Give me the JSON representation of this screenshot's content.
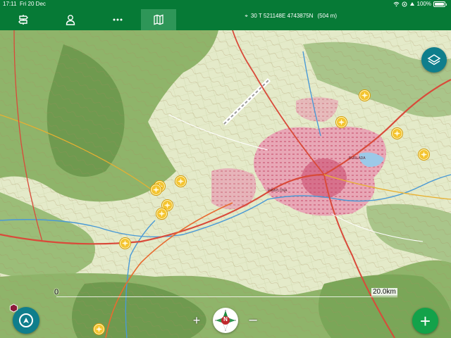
{
  "status_bar": {
    "time": "17:11",
    "date": "Fri 20 Dec",
    "battery": "100%",
    "icons": [
      "wifi-icon",
      "location-icon",
      "orientation-lock-icon",
      "battery-icon"
    ]
  },
  "toolbar": {
    "tabs": [
      {
        "name": "tab-routes",
        "icon": "signpost-icon",
        "active": false
      },
      {
        "name": "tab-profile",
        "icon": "user-icon",
        "active": false
      },
      {
        "name": "tab-more",
        "icon": "more-dots-icon",
        "active": false
      },
      {
        "name": "tab-map",
        "icon": "folded-map-icon",
        "active": true
      }
    ],
    "coordinates": "30 T 521148E 4743875N",
    "altitude": "(504 m)",
    "accent_color": "#067a36",
    "active_tab_color": "#2e9658"
  },
  "map": {
    "town_labels": [
      "PAMPLONA",
      "BURLADA"
    ],
    "scale_start": "0",
    "scale_end": "20.0km",
    "compass_label": "N",
    "zoom_in_label": "+",
    "zoom_out_label": "–",
    "add_label": "+",
    "poi_icon": "sun-star-icon",
    "poi_color": "#f4c430",
    "button_color": "#0f7e8c",
    "add_button_color": "#13a24a"
  }
}
